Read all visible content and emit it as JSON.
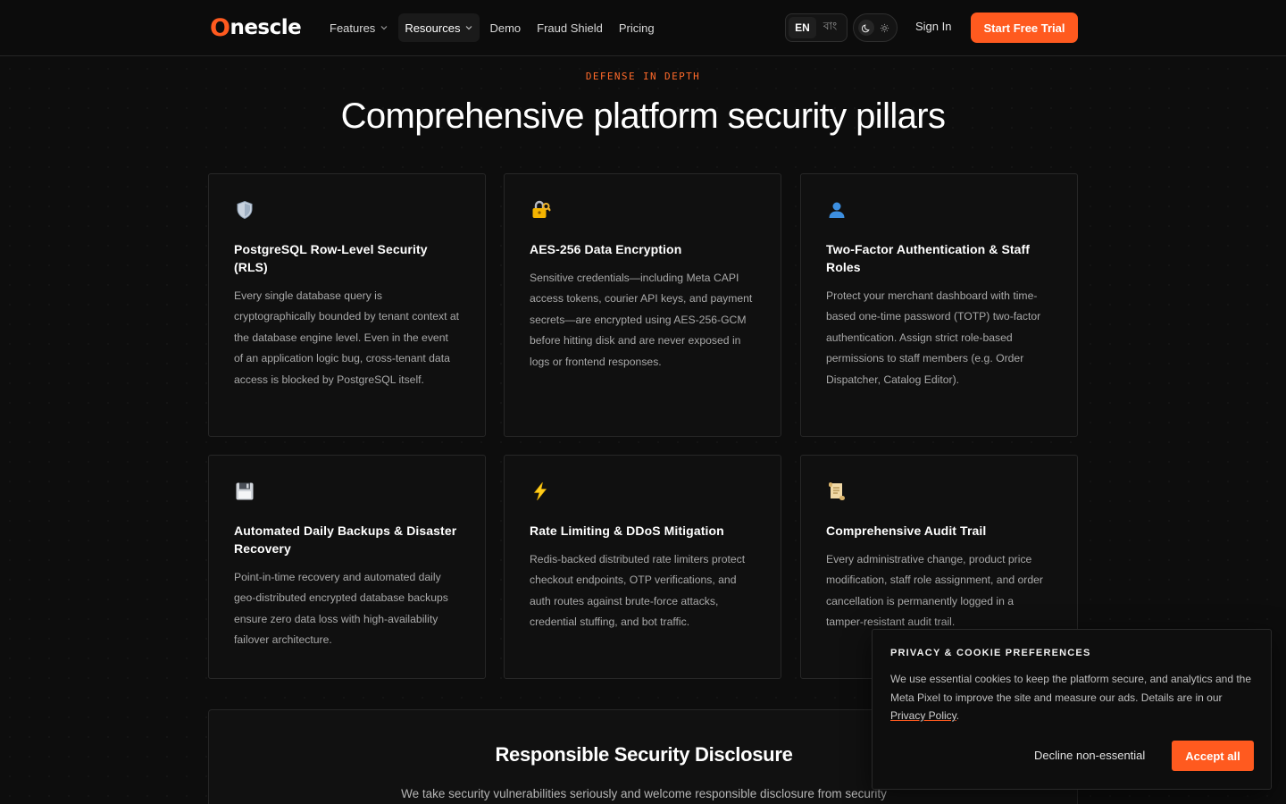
{
  "nav": {
    "logo_o": "O",
    "logo_rest": "nescle",
    "items": [
      {
        "label": "Features",
        "dropdown": true
      },
      {
        "label": "Resources",
        "dropdown": true
      },
      {
        "label": "Demo",
        "dropdown": false
      },
      {
        "label": "Fraud Shield",
        "dropdown": false
      },
      {
        "label": "Pricing",
        "dropdown": false
      }
    ],
    "lang": {
      "en": "EN",
      "bn": "বাং"
    },
    "signin": "Sign In",
    "cta": "Start Free Trial"
  },
  "section": {
    "eyebrow": "DEFENSE IN DEPTH",
    "headline": "Comprehensive platform security pillars"
  },
  "cards": [
    {
      "icon": "shield-icon",
      "title": "PostgreSQL Row-Level Security (RLS)",
      "desc": "Every single database query is cryptographically bounded by tenant context at the database engine level. Even in the event of an application logic bug, cross-tenant data access is blocked by PostgreSQL itself."
    },
    {
      "icon": "lock-key-icon",
      "title": "AES-256 Data Encryption",
      "desc": "Sensitive credentials—including Meta CAPI access tokens, courier API keys, and payment secrets—are encrypted using AES-256-GCM before hitting disk and are never exposed in logs or frontend responses."
    },
    {
      "icon": "user-icon",
      "title": "Two-Factor Authentication & Staff Roles",
      "desc": "Protect your merchant dashboard with time-based one-time password (TOTP) two-factor authentication. Assign strict role-based permissions to staff members (e.g. Order Dispatcher, Catalog Editor)."
    },
    {
      "icon": "floppy-disk-icon",
      "title": "Automated Daily Backups & Disaster Recovery",
      "desc": "Point-in-time recovery and automated daily geo-distributed encrypted database backups ensure zero data loss with high-availability failover architecture."
    },
    {
      "icon": "lightning-icon",
      "title": "Rate Limiting & DDoS Mitigation",
      "desc": "Redis-backed distributed rate limiters protect checkout endpoints, OTP verifications, and auth routes against brute-force attacks, credential stuffing, and bot traffic."
    },
    {
      "icon": "scroll-icon",
      "title": "Comprehensive Audit Trail",
      "desc": "Every administrative change, product price modification, staff role assignment, and order cancellation is permanently logged in a tamper-resistant audit trail."
    }
  ],
  "disclosure": {
    "title": "Responsible Security Disclosure",
    "text": "We take security vulnerabilities seriously and welcome responsible disclosure from security"
  },
  "cookie": {
    "title": "PRIVACY & COOKIE PREFERENCES",
    "text": "We use essential cookies to keep the platform secure, and analytics and the Meta Pixel to improve the site and measure our ads. Details are in our ",
    "link": "Privacy Policy",
    "after_link": ".",
    "decline": "Decline non-essential",
    "accept": "Accept all"
  },
  "colors": {
    "accent": "#ff5a1f",
    "background": "#0d0d0d",
    "card_border": "#272727"
  }
}
